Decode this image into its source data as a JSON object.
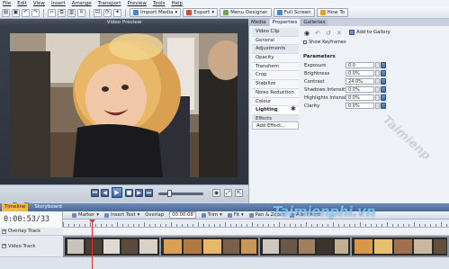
{
  "menu": [
    "File",
    "Edit",
    "View",
    "Insert",
    "Arrange",
    "Transport",
    "Preview",
    "Tools",
    "Help"
  ],
  "toolbar": {
    "import_media": "Import Media",
    "export": "Export",
    "menu_designer": "Menu Designer",
    "full_screen": "Full Screen",
    "how_to": "How To"
  },
  "preview": {
    "title": "Video Preview"
  },
  "panel": {
    "tabs": [
      "Media",
      "Properties",
      "Galleries"
    ],
    "active_tab": "Properties",
    "list": [
      "Video Clip",
      "General",
      "Adjustments",
      "Opacity",
      "Transform",
      "Crop",
      "Stabilize",
      "Noise Reduction",
      "Colour",
      "Lighting",
      "Effects"
    ],
    "selected": "Lighting",
    "add_effect": "Add Effect...",
    "add_to_gallery": "Add to Gallery",
    "show_keyframes": "Show Keyframes",
    "parameters_title": "Parameters",
    "params": [
      {
        "label": "Exposure",
        "value": "0.0"
      },
      {
        "label": "Brightness",
        "value": "0.0%"
      },
      {
        "label": "Contrast",
        "value": "24.0%"
      },
      {
        "label": "Shadows Intensity",
        "value": "0.0%"
      },
      {
        "label": "Highlights Intensity",
        "value": "0.0%"
      },
      {
        "label": "Clarity",
        "value": "0.0%"
      }
    ]
  },
  "timeline": {
    "tabs": [
      "Timeline",
      "Storyboard"
    ],
    "active_tab": "Timeline",
    "time": "0:00:53/33",
    "tools": [
      "Marker",
      "Insert Text",
      "Overlap",
      "00:00:08",
      "Trim",
      "Fit",
      "Pan & Zoom",
      "Add Effect"
    ],
    "tracks": [
      "Overlay Track",
      "Video Track"
    ]
  },
  "watermark": "Taimienphi.vn",
  "watermark2": "Taimienp",
  "colors": {
    "accent": "#4b6a96",
    "selected_tab": "#f0b84a",
    "playhead": "#e03232"
  }
}
